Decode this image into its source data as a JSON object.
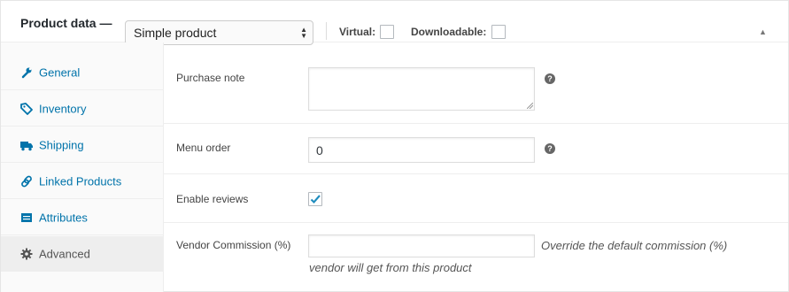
{
  "header": {
    "title": "Product data —",
    "product_type": "Simple product",
    "virtual_label": "Virtual:",
    "downloadable_label": "Downloadable:"
  },
  "sidebar": {
    "items": [
      {
        "label": "General",
        "icon": "wrench-icon"
      },
      {
        "label": "Inventory",
        "icon": "tag-icon"
      },
      {
        "label": "Shipping",
        "icon": "truck-icon"
      },
      {
        "label": "Linked Products",
        "icon": "link-icon"
      },
      {
        "label": "Attributes",
        "icon": "list-icon"
      },
      {
        "label": "Advanced",
        "icon": "gear-icon"
      }
    ],
    "active": "Advanced"
  },
  "fields": {
    "purchase_note": {
      "label": "Purchase note",
      "value": ""
    },
    "menu_order": {
      "label": "Menu order",
      "value": "0"
    },
    "enable_reviews": {
      "label": "Enable reviews",
      "checked": true
    },
    "vendor_commission": {
      "label": "Vendor Commission (%)",
      "value": "",
      "description_line1": "Override the default commission (%)",
      "description_line2": "vendor will get from this product"
    }
  },
  "colors": {
    "link": "#0073aa",
    "check": "#1e8cbe"
  }
}
